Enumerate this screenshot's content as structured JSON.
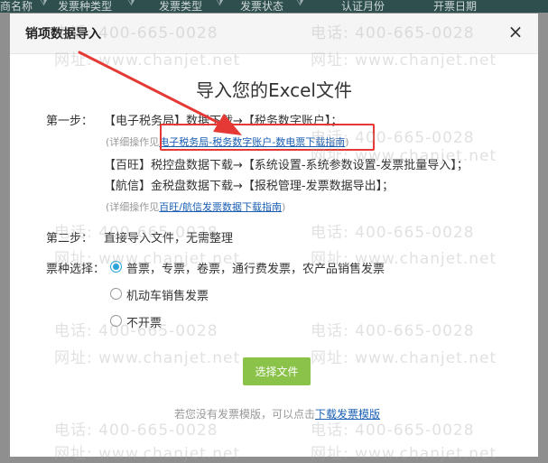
{
  "background_header": {
    "columns": [
      "商名称",
      "发票种类型",
      "发票类型",
      "发票状态",
      "认证月份",
      "开票日期"
    ]
  },
  "dialog": {
    "title": "销项数据导入",
    "close_icon": "×",
    "main_title": "导入您的Excel文件",
    "step1": {
      "label": "第一步：",
      "line1": "【电子税务局】数据下载→【税务数字账户】；",
      "hint1_prefix": "(详细操作见",
      "hint1_link": "电子税务局-税务数字账户-数电票下载指南",
      "hint1_suffix": ")",
      "line2": "【百旺】税控盘数据下载→【系统设置-系统参数设置-发票批量导入】；",
      "line3": "【航信】金税盘数据下载→【报税管理-发票数据导出】；",
      "hint2_prefix": "(详细操作见",
      "hint2_link": "百旺/航信发票数据下载指南",
      "hint2_suffix": ")"
    },
    "step2": {
      "label": "第二步：",
      "text": "直接导入文件，无需整理"
    },
    "ticket_type": {
      "label": "票种选择：",
      "options": [
        "普票，专票，卷票，通行费发票，农产品销售发票",
        "机动车销售发票",
        "不开票"
      ],
      "selected_index": 0
    },
    "choose_file_button": "选择文件",
    "footer": {
      "prefix": "若您没有发票模版，可以点击",
      "link": "下载发票模版"
    }
  },
  "watermark": {
    "phone": "电话: 400-665-0028",
    "site": "网址: www.chanjet.net"
  },
  "colors": {
    "accent_button": "#8bc34a",
    "radio_selected": "#2aa3d8",
    "highlight_box": "#e53935",
    "link": "#1a5fb4"
  }
}
